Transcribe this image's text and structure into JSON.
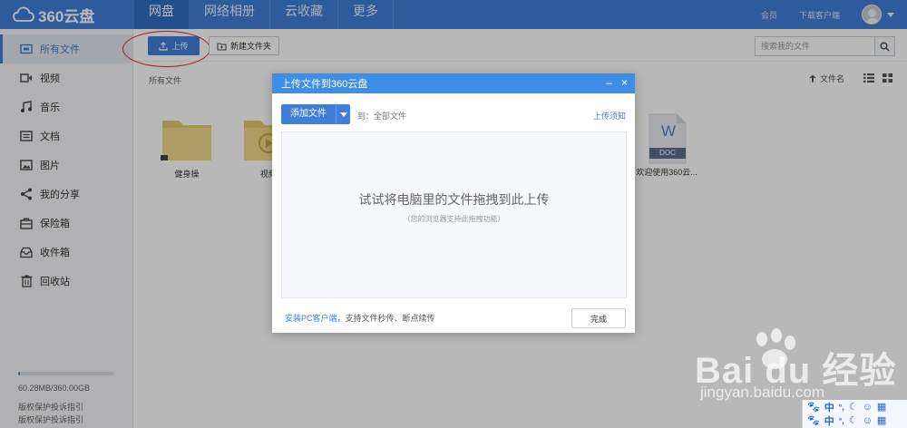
{
  "app": {
    "logo_text": "360云盘"
  },
  "nav": {
    "items": [
      "网盘",
      "网络相册",
      "云收藏",
      "更多"
    ],
    "active": 0
  },
  "top_right": {
    "member": "会员",
    "download_client": "下载客户端"
  },
  "sidebar": {
    "items": [
      {
        "label": "所有文件",
        "icon": "folder-icon",
        "active": true
      },
      {
        "label": "视频",
        "icon": "video-icon"
      },
      {
        "label": "音乐",
        "icon": "music-icon"
      },
      {
        "label": "文档",
        "icon": "document-icon"
      },
      {
        "label": "图片",
        "icon": "image-icon"
      },
      {
        "label": "我的分享",
        "icon": "share-icon"
      },
      {
        "label": "保险箱",
        "icon": "safe-icon"
      },
      {
        "label": "收件箱",
        "icon": "inbox-icon"
      },
      {
        "label": "回收站",
        "icon": "trash-icon"
      }
    ],
    "storage_text": "60.28MB/360.00GB",
    "storage_used_fraction": 0.02,
    "footer_1": "版权保护投诉指引",
    "footer_2": "版权保护投诉指引"
  },
  "toolbar": {
    "upload_label": "上传",
    "new_folder_label": "新建文件夹",
    "search_placeholder": "搜索我的文件"
  },
  "breadcrumb": "所有文件",
  "sort_label": "文件名",
  "files": [
    {
      "name": "健身操",
      "type": "folder",
      "icon": "folder-icon"
    },
    {
      "name": "视频",
      "type": "video-folder",
      "icon": "video-folder-icon"
    },
    {
      "name": "欢迎使用360云...",
      "type": "doc",
      "icon": "doc-file-icon",
      "badge": "DOC"
    }
  ],
  "modal": {
    "title": "上传文件到360云盘",
    "add_file_label": "添加文件",
    "destination": "到：全部文件",
    "upload_notice": "上传须知",
    "drop_main": "试试将电脑里的文件拖拽到此上传",
    "drop_sub": "（您的浏览器支持此拖拽功能）",
    "footer_link": "安装PC客户端",
    "footer_text": "，支持文件秒传、断点续传",
    "done_label": "完成"
  },
  "watermark": {
    "brand": "Bai du 经验",
    "url": "jingyan.baidu.com"
  },
  "ime": {
    "row_1": "中",
    "row_2": "中"
  },
  "colors": {
    "accent": "#3f7fd9",
    "topbar": "#3f7fd9",
    "modal_header": "#3f8ee6",
    "annotation_red": "#e0302a"
  }
}
